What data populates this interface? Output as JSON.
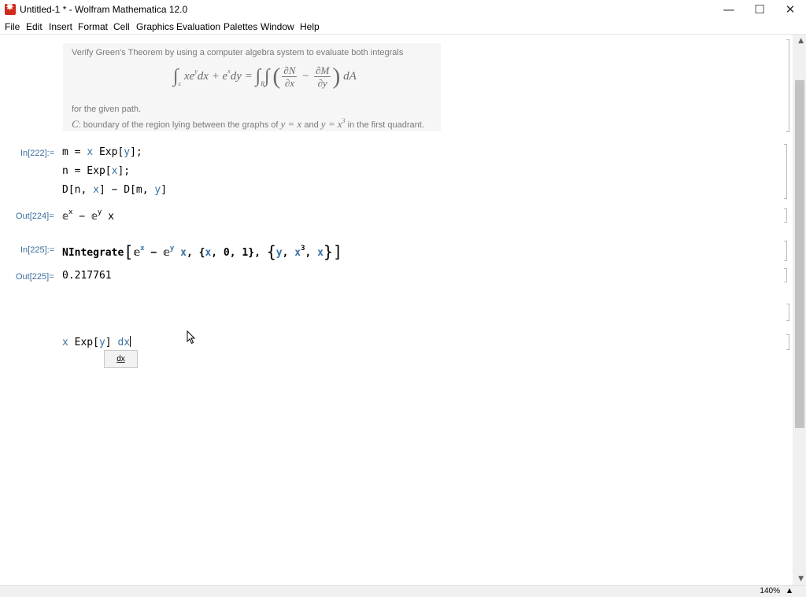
{
  "window": {
    "title": "Untitled-1 * - Wolfram Mathematica 12.0"
  },
  "menu": [
    "File",
    "Edit",
    "Insert",
    "Format",
    "Cell",
    "Graphics",
    "Evaluation",
    "Palettes",
    "Window",
    "Help"
  ],
  "text_cell": {
    "line1": "Verify Green's Theorem by using a computer algebra system to evaluate both integrals",
    "line3": "for the given path.",
    "line4_c": "C",
    "line4_a": ": boundary of the region lying between the graphs of ",
    "line4_eq1": "y = x",
    "line4_and": " and ",
    "line4_eq2": "y = x",
    "line4_eq2_exp": "3",
    "line4_end": " in the first quadrant."
  },
  "cells": {
    "in222": "In[222]:=",
    "out224": "Out[224]=",
    "in225": "In[225]:=",
    "out225": "Out[225]=",
    "out225_value": "0.217761"
  },
  "autocomplete": {
    "suggestion": "dx"
  },
  "status": {
    "zoom": "140%"
  }
}
